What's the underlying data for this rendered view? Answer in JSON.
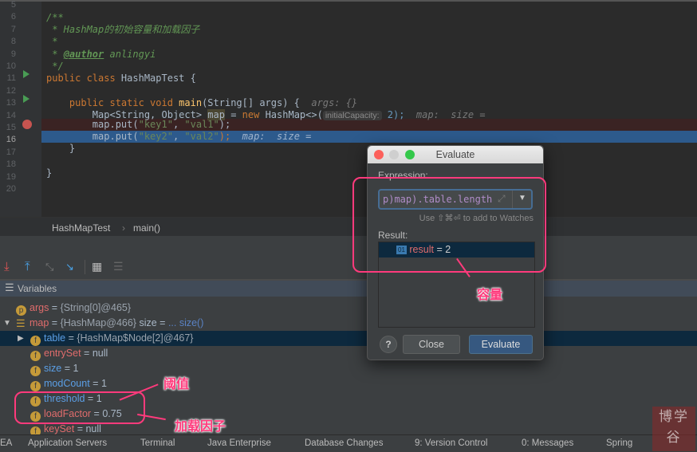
{
  "editor": {
    "line_numbers": [
      "5",
      "6",
      "7",
      "8",
      "9",
      "10",
      "11",
      "12",
      "13",
      "14",
      "15",
      "16",
      "17",
      "18",
      "19",
      "20"
    ],
    "comment_open": "/**",
    "comment_title": " * HashMap的初始容量和加载因子",
    "comment_star": " *",
    "comment_author_prefix": " * ",
    "comment_author_tag": "@author",
    "comment_author_name": " anlingyi",
    "comment_close": " */",
    "l11_kw": "public class ",
    "l11_rest": "HashMapTest {",
    "l13_kw": "    public static void ",
    "l13_fn": "main",
    "l13_rest": "(String[] args) {  ",
    "l13_hint": "args: {}",
    "l14_a": "        Map<String, Object> ",
    "l14_map": "map",
    "l14_b": " = ",
    "l14_new": "new ",
    "l14_c": "HashMap<>(",
    "l14_param": "initialCapacity:",
    "l14_d": " 2);  ",
    "l14_hint": "map:  size =",
    "l15_a": "        map.put(",
    "l15_s1": "\"key1\"",
    "l15_b": ", ",
    "l15_s2": "\"val1\"",
    "l15_c": ");",
    "l16_a": "        map.put(",
    "l16_s1": "\"key2\"",
    "l16_b": ", ",
    "l16_s2": "\"val2\"",
    "l16_c": ");  ",
    "l16_hint": "map:  size =",
    "l17": "    }",
    "l19": "}"
  },
  "breadcrumb": [
    "HashMapTest",
    "main()"
  ],
  "variables": {
    "header": "Variables",
    "rows": [
      {
        "badge": "p",
        "name": "args",
        "eq": " = ",
        "value": "{String[0]@465}"
      },
      {
        "name": "map",
        "eq": " = ",
        "value": "{HashMap@466}",
        "extra": "  size = ",
        "extra2": "... size()"
      },
      {
        "badge": "f",
        "name": "table",
        "eq": " = ",
        "value": "{HashMap$Node[2]@467}"
      },
      {
        "badge": "f",
        "name": "entrySet",
        "eq": " = ",
        "value": "null"
      },
      {
        "badge": "f",
        "name": "size",
        "eq": " = ",
        "value": "1"
      },
      {
        "badge": "f",
        "name": "modCount",
        "eq": " = ",
        "value": "1"
      },
      {
        "badge": "f",
        "name": "threshold",
        "eq": " = ",
        "value": "1"
      },
      {
        "badge": "f",
        "name": "loadFactor",
        "eq": " = ",
        "value": "0.75"
      },
      {
        "badge": "f",
        "name": "keySet",
        "eq": " = ",
        "value": "null"
      }
    ]
  },
  "evaluate": {
    "title": "Evaluate",
    "expression_label": "Expression:",
    "expression_value": "p)map).table.length",
    "hint": "Use ⇧⌘⏎ to add to Watches",
    "result_label": "Result:",
    "result_badge": "01",
    "result_name": "result",
    "result_eq": " = 2",
    "help": "?",
    "close": "Close",
    "evaluate": "Evaluate"
  },
  "annotations": {
    "capacity": "容量",
    "threshold": "阈值",
    "load_factor": "加载因子"
  },
  "status_bar": [
    "EA",
    "Application Servers",
    "Terminal",
    "Java Enterprise",
    "Database Changes",
    "9: Version Control",
    "0: Messages",
    "Spring"
  ],
  "watermark": "博学谷",
  "colors": {
    "accent": "#ff3a7c",
    "selection": "#2d5a8c"
  }
}
